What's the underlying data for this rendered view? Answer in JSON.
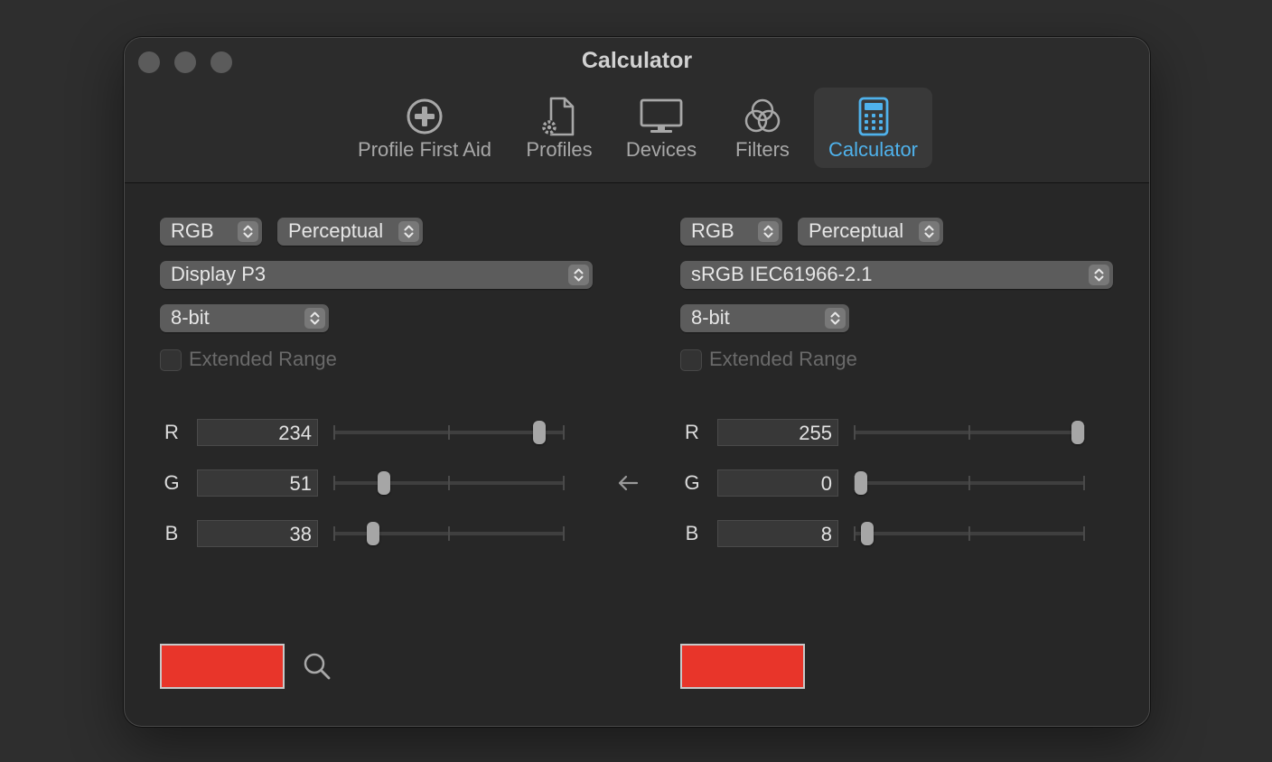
{
  "window": {
    "title": "Calculator"
  },
  "toolbar": {
    "tabs": [
      {
        "label": "Profile First Aid",
        "icon": "first-aid-icon"
      },
      {
        "label": "Profiles",
        "icon": "profile-document-gear-icon"
      },
      {
        "label": "Devices",
        "icon": "display-icon"
      },
      {
        "label": "Filters",
        "icon": "filters-circles-icon"
      },
      {
        "label": "Calculator",
        "icon": "calculator-icon"
      }
    ],
    "active_tab": "Calculator"
  },
  "colors": {
    "accent": "#4fb2ec",
    "left_swatch": "#e8352a",
    "right_swatch": "#e8352a"
  },
  "left": {
    "color_space": "RGB",
    "intent": "Perceptual",
    "profile": "Display P3",
    "depth": "8-bit",
    "extended_range_label": "Extended Range",
    "extended_range_checked": false,
    "channels": [
      {
        "label": "R",
        "value": "234",
        "fraction": 0.918
      },
      {
        "label": "G",
        "value": "51",
        "fraction": 0.2
      },
      {
        "label": "B",
        "value": "38",
        "fraction": 0.149
      }
    ]
  },
  "right": {
    "color_space": "RGB",
    "intent": "Perceptual",
    "profile": "sRGB IEC61966-2.1",
    "depth": "8-bit",
    "extended_range_label": "Extended Range",
    "extended_range_checked": false,
    "channels": [
      {
        "label": "R",
        "value": "255",
        "fraction": 1.0
      },
      {
        "label": "G",
        "value": "0",
        "fraction": 0.0
      },
      {
        "label": "B",
        "value": "8",
        "fraction": 0.031
      }
    ]
  },
  "conversion_direction": "right-to-left"
}
